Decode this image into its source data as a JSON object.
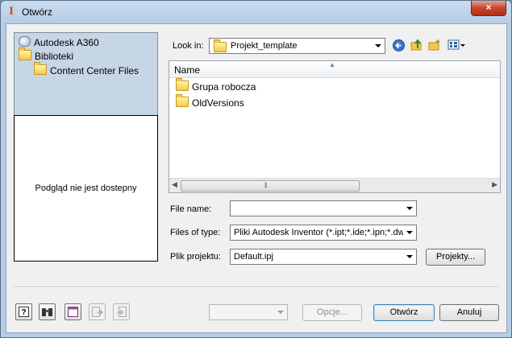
{
  "window": {
    "title": "Otwórz",
    "close_symbol": "×"
  },
  "places": [
    {
      "label": "Autodesk A360",
      "icon": "cloud-icon"
    },
    {
      "label": "Biblioteki",
      "icon": "folder-icon"
    },
    {
      "label": "Content Center Files",
      "icon": "folder-icon"
    }
  ],
  "preview": {
    "text": "Podgląd nie jest dostepny"
  },
  "look_in": {
    "label": "Look in:",
    "value": "Projekt_template"
  },
  "toolbar": {
    "back_icon": "back-icon",
    "up_icon": "up-folder-icon",
    "new_folder_icon": "new-folder-icon",
    "view_icon": "view-menu-icon"
  },
  "file_list": {
    "column": "Name",
    "items": [
      "Grupa robocza",
      "OldVersions"
    ]
  },
  "file_name": {
    "label": "File name:",
    "value": ""
  },
  "files_of_type": {
    "label": "Files of type:",
    "value": "Pliki Autodesk Inventor (*.ipt;*.ide;*.ipn;*.dwg"
  },
  "project_file": {
    "label": "Plik projektu:",
    "value": "Default.ipj",
    "button": "Projekty..."
  },
  "bottom": {
    "options_button": "Opcje...",
    "open_button": "Otwórz",
    "cancel_button": "Anuluj",
    "icons": [
      "help-icon",
      "find-binoculars-icon",
      "preview-pane-icon",
      "export-icon",
      "import-icon"
    ]
  },
  "colors": {
    "title_bg": "#c9dbee",
    "places_bg": "#c7d6e5",
    "close_btn": "#c7452c"
  }
}
